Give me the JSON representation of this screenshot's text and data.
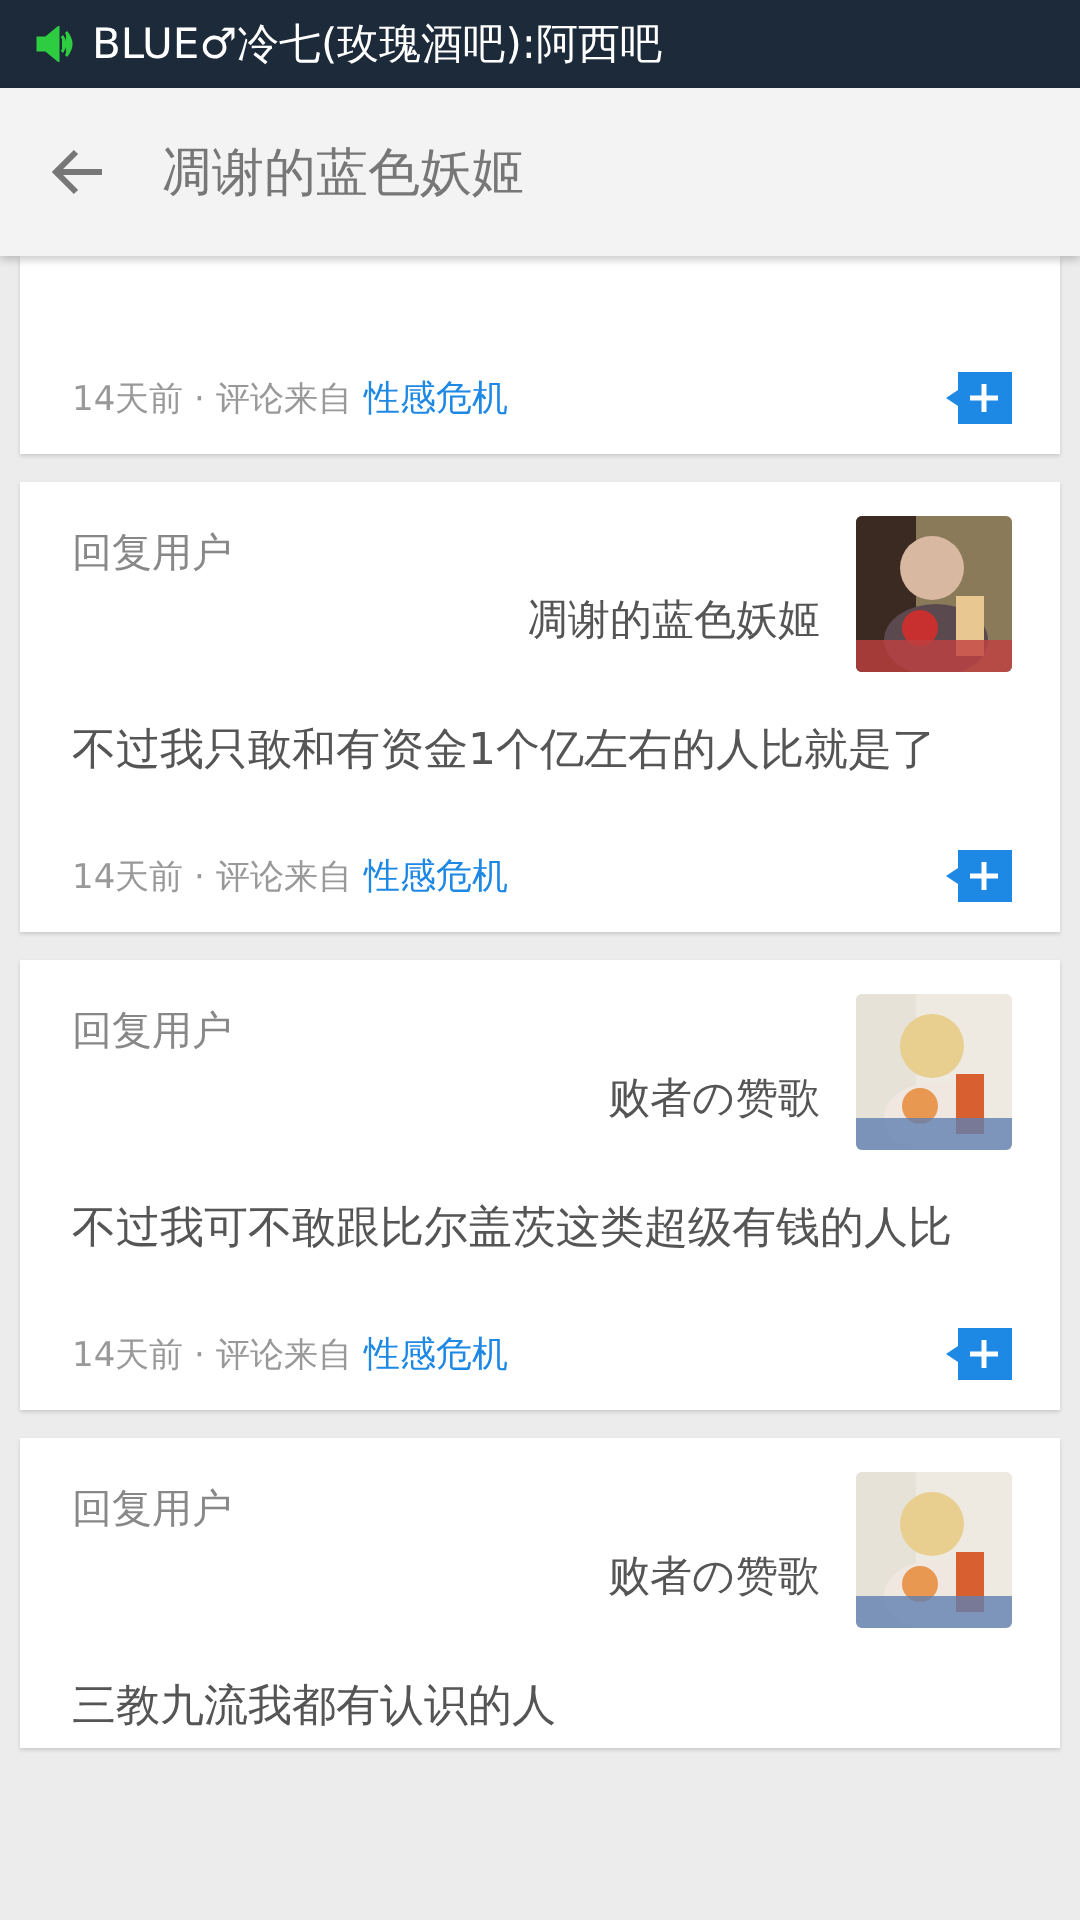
{
  "status_bar": {
    "notification": "BLUE♂冷七(玫瑰酒吧):阿西吧"
  },
  "header": {
    "title": "凋谢的蓝色妖姬"
  },
  "comments": [
    {
      "time": "14天前 · 评论来自",
      "source": "性感危机"
    },
    {
      "label": "回复用户",
      "user": "凋谢的蓝色妖姬",
      "body": "不过我只敢和有资金1个亿左右的人比就是了",
      "time": "14天前 · 评论来自",
      "source": "性感危机"
    },
    {
      "label": "回复用户",
      "user": "败者の赞歌",
      "body": "不过我可不敢跟比尔盖茨这类超级有钱的人比",
      "time": "14天前 · 评论来自",
      "source": "性感危机"
    },
    {
      "label": "回复用户",
      "user": "败者の赞歌",
      "body": "三教九流我都有认识的人"
    }
  ]
}
